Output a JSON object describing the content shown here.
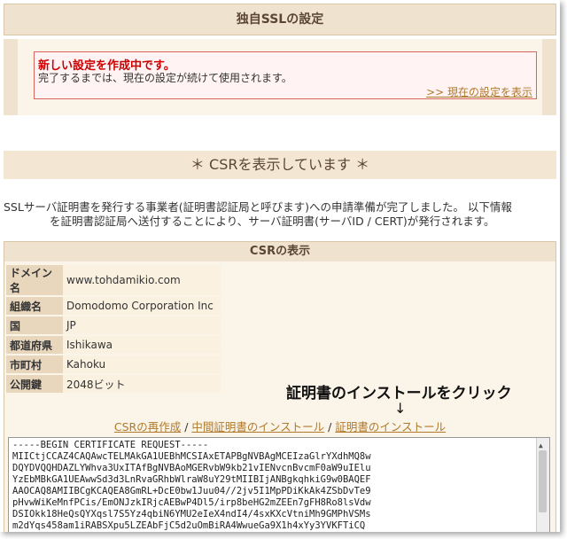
{
  "page": {
    "title": "独自SSLの設定"
  },
  "notice": {
    "title": "新しい設定を作成中です。",
    "text": "完了するまでは、現在の設定が続けて使用されます。",
    "link": ">> 現在の設定を表示"
  },
  "section": {
    "star_left": "＊",
    "title": "CSRを表示しています",
    "star_right": "＊"
  },
  "description": {
    "line1": "SSLサーバ証明書を発行する事業者(証明書認証局と呼びます)への申請準備が完了しました。 以下情報",
    "line2": "を証明書認証局へ送付することにより、サーバ証明書(サーバID / CERT)が発行されます。"
  },
  "csr": {
    "header": "CSRの表示",
    "rows": [
      {
        "label": "ドメイン名",
        "value": "www.tohdamikio.com"
      },
      {
        "label": "組織名",
        "value": "Domodomo Corporation Inc"
      },
      {
        "label": "国",
        "value": "JP"
      },
      {
        "label": "都道府県",
        "value": "Ishikawa"
      },
      {
        "label": "市町村",
        "value": "Kahoku"
      },
      {
        "label": "公開鍵",
        "value": "2048ビット"
      }
    ],
    "annotation": "証明書のインストールをクリック",
    "arrow": "↓",
    "links": {
      "regen": "CSRの再作成",
      "sep1": " / ",
      "intermediate": "中間証明書のインストール",
      "sep2": " / ",
      "install": "証明書のインストール"
    },
    "text_lines": [
      "-----BEGIN CERTIFICATE REQUEST-----",
      "MIICtjCCAZ4CAQAwcTELMAkGA1UEBhMCSIAxETAPBgNVBAgMCEIzaGlrYXdhMQ8w",
      "DQYDVQQHDAZLYWhva3UxITAfBgNVBAoMGERvbW9kb21vIENvcnBvcmF0aW9uIElu",
      "YzEbMBkGA1UEAwwSd3d3LnRvaGRhbWlraW8uY29tMIIBIjANBgkqhkiG9w0BAQEF",
      "AAOCAQ8AMIIBCgKCAQEA8GmRL+DcE0bw1Juu04//2jv5I1MpPDiKkAk4ZSbDvTe9",
      "pHvwWiKeMnfPCis/EmONJzkIRjcAEBwP4Dl5/irp8beHG2mZEEn7gFH8Ro8lsVdw",
      "DSIOkk18HeQsQYXqsl7S5Yz4qbiN6YMU2eIeX4ndI4/4sxKXcVtniMh9GMPhVSMs",
      "m2dYqs458am1iRABSXpu5LZEAbFjC5d2uOmBiRA4WwueGa9X1h4xYy3YVKFTiCQ"
    ]
  }
}
